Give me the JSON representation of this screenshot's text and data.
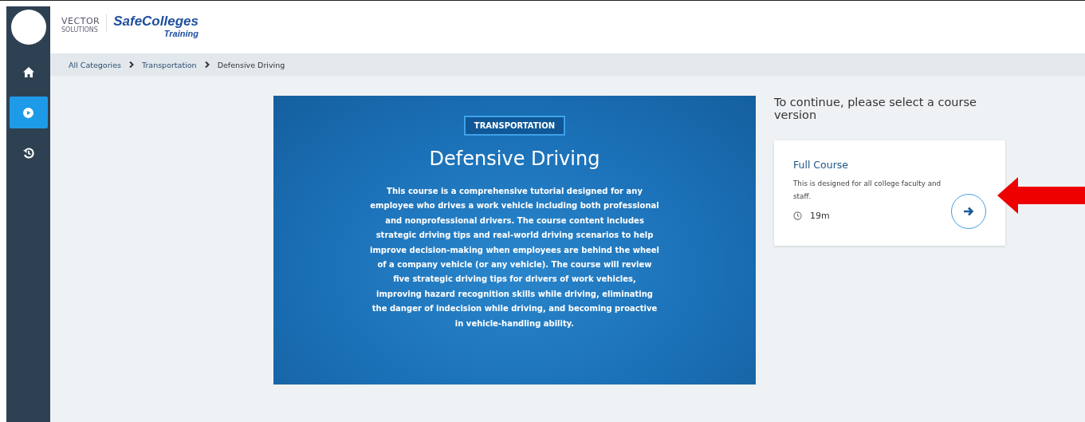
{
  "logo": {
    "vendor": "VECTOR",
    "vendor_sub": "SOLUTIONS",
    "brand": "SafeColleges",
    "brand_sub": "Training"
  },
  "sidebar": {
    "items": [
      {
        "kind": "home",
        "selected": false
      },
      {
        "kind": "play",
        "selected": true
      },
      {
        "kind": "history",
        "selected": false
      }
    ]
  },
  "breadcrumb": [
    "All Categories",
    "Transportation",
    "Defensive Driving"
  ],
  "course": {
    "category": "TRANSPORTATION",
    "title": "Defensive Driving",
    "description": "This course is a comprehensive tutorial designed for any employee who drives a work vehicle including both professional and nonprofessional drivers. The course content includes strategic driving tips and real-world driving scenarios to help improve decision-making when employees are behind the wheel of a company vehicle (or any vehicle). The course will review five strategic driving tips for drivers of work vehicles, improving hazard recognition skills while driving, eliminating the danger of indecision while driving, and becoming proactive in vehicle-handling ability."
  },
  "versions": {
    "heading": "To continue, please select a course version",
    "items": [
      {
        "title": "Full Course",
        "description": "This is designed for all college faculty and staff.",
        "duration": "19m"
      }
    ]
  }
}
